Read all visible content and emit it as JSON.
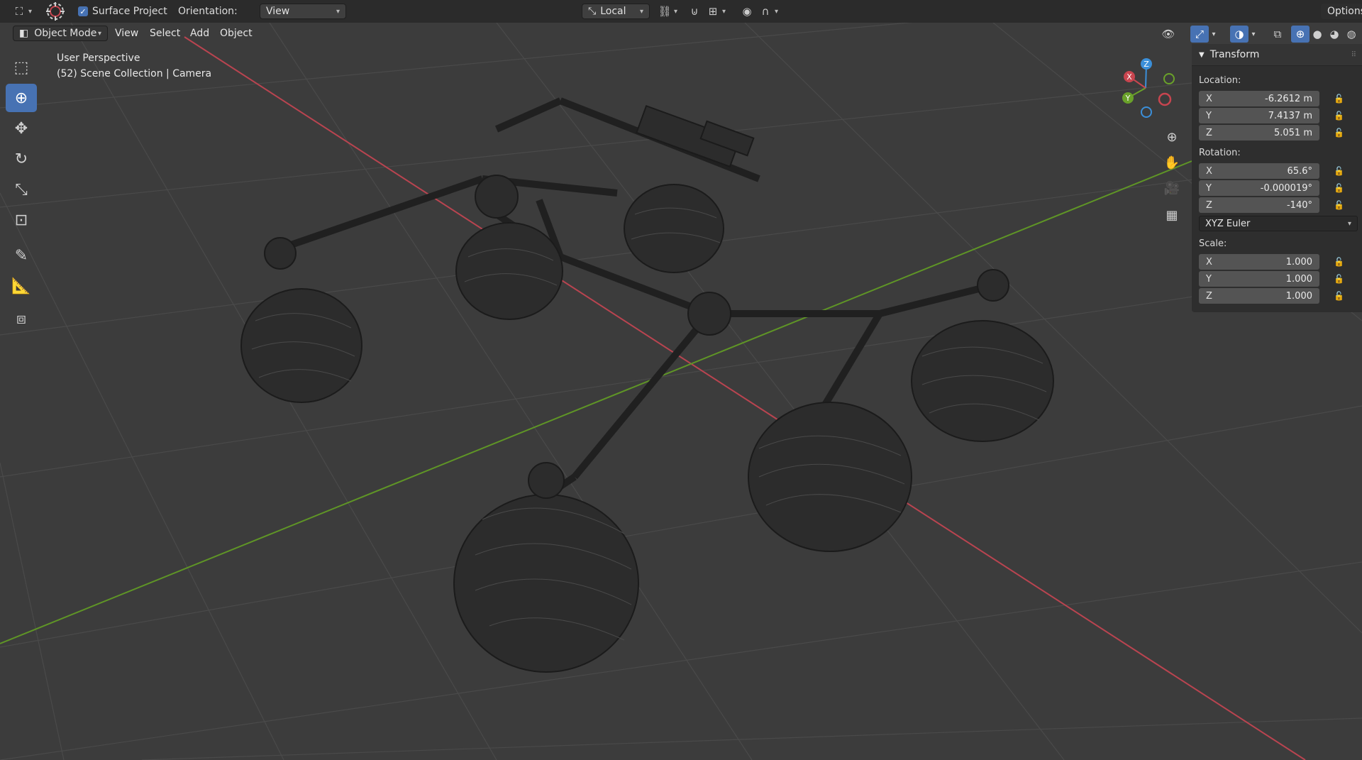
{
  "topbar": {
    "surface_project_label": "Surface Project",
    "orientation_label": "Orientation:",
    "orientation_value": "View",
    "pivot_value": "Local",
    "options_label": "Options"
  },
  "header": {
    "mode": "Object Mode",
    "menus": [
      "View",
      "Select",
      "Add",
      "Object"
    ]
  },
  "viewport": {
    "perspective_label": "User Perspective",
    "collection_label": "(52) Scene Collection | Camera"
  },
  "gizmo": {
    "x": "X",
    "y": "Y",
    "z": "Z"
  },
  "transform": {
    "title": "Transform",
    "location_label": "Location:",
    "location": [
      {
        "axis": "X",
        "value": "-6.2612 m"
      },
      {
        "axis": "Y",
        "value": "7.4137 m"
      },
      {
        "axis": "Z",
        "value": "5.051 m"
      }
    ],
    "rotation_label": "Rotation:",
    "rotation": [
      {
        "axis": "X",
        "value": "65.6°"
      },
      {
        "axis": "Y",
        "value": "-0.000019°"
      },
      {
        "axis": "Z",
        "value": "-140°"
      }
    ],
    "rotation_mode": "XYZ Euler",
    "scale_label": "Scale:",
    "scale": [
      {
        "axis": "X",
        "value": "1.000"
      },
      {
        "axis": "Y",
        "value": "1.000"
      },
      {
        "axis": "Z",
        "value": "1.000"
      }
    ]
  },
  "colors": {
    "accent": "#4772b3",
    "x_axis": "#c8454f",
    "y_axis": "#6aa12a",
    "z_axis": "#3b8fd9"
  }
}
